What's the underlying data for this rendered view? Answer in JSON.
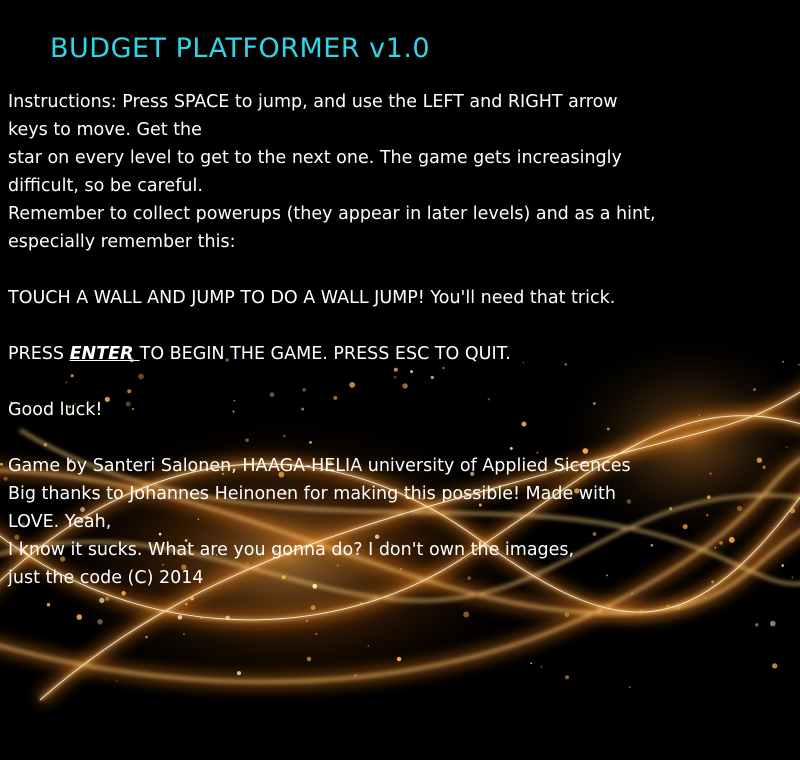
{
  "title": "BUDGET PLATFORMER v1.0",
  "instructions": {
    "line1": "Instructions: Press SPACE to jump, and use the LEFT and RIGHT arrow",
    "line2": "keys to move. Get the",
    "line3": "star on every level to get to the next one. The game gets increasingly",
    "line4": "difficult, so be careful.",
    "line5": "Remember to collect powerups (they appear in later levels) and as a hint,",
    "line6": "especially remember this:"
  },
  "wall_jump_tip": "TOUCH A WALL AND JUMP TO DO A WALL JUMP! You'll need that trick.",
  "start_prompt": {
    "prefix": "PRESS ",
    "key": "ENTER ",
    "suffix": "TO BEGIN THE GAME. PRESS ESC TO QUIT."
  },
  "good_luck": "Good luck!",
  "credits": {
    "line1": "Game by Santeri Salonen, HAAGA-HELIA university of Applied Sicences",
    "line2": "Big thanks to Johannes Heinonen for making this possible! Made with",
    "line3": "LOVE. Yeah,",
    "line4": "I know it sucks. What are you gonna do? I don't own the images,",
    "line5": "just the code (C) 2014"
  },
  "colors": {
    "background": "#000000",
    "title": "#2fd6e6",
    "text": "#ffffff",
    "light_streaks": "#ffa640"
  }
}
